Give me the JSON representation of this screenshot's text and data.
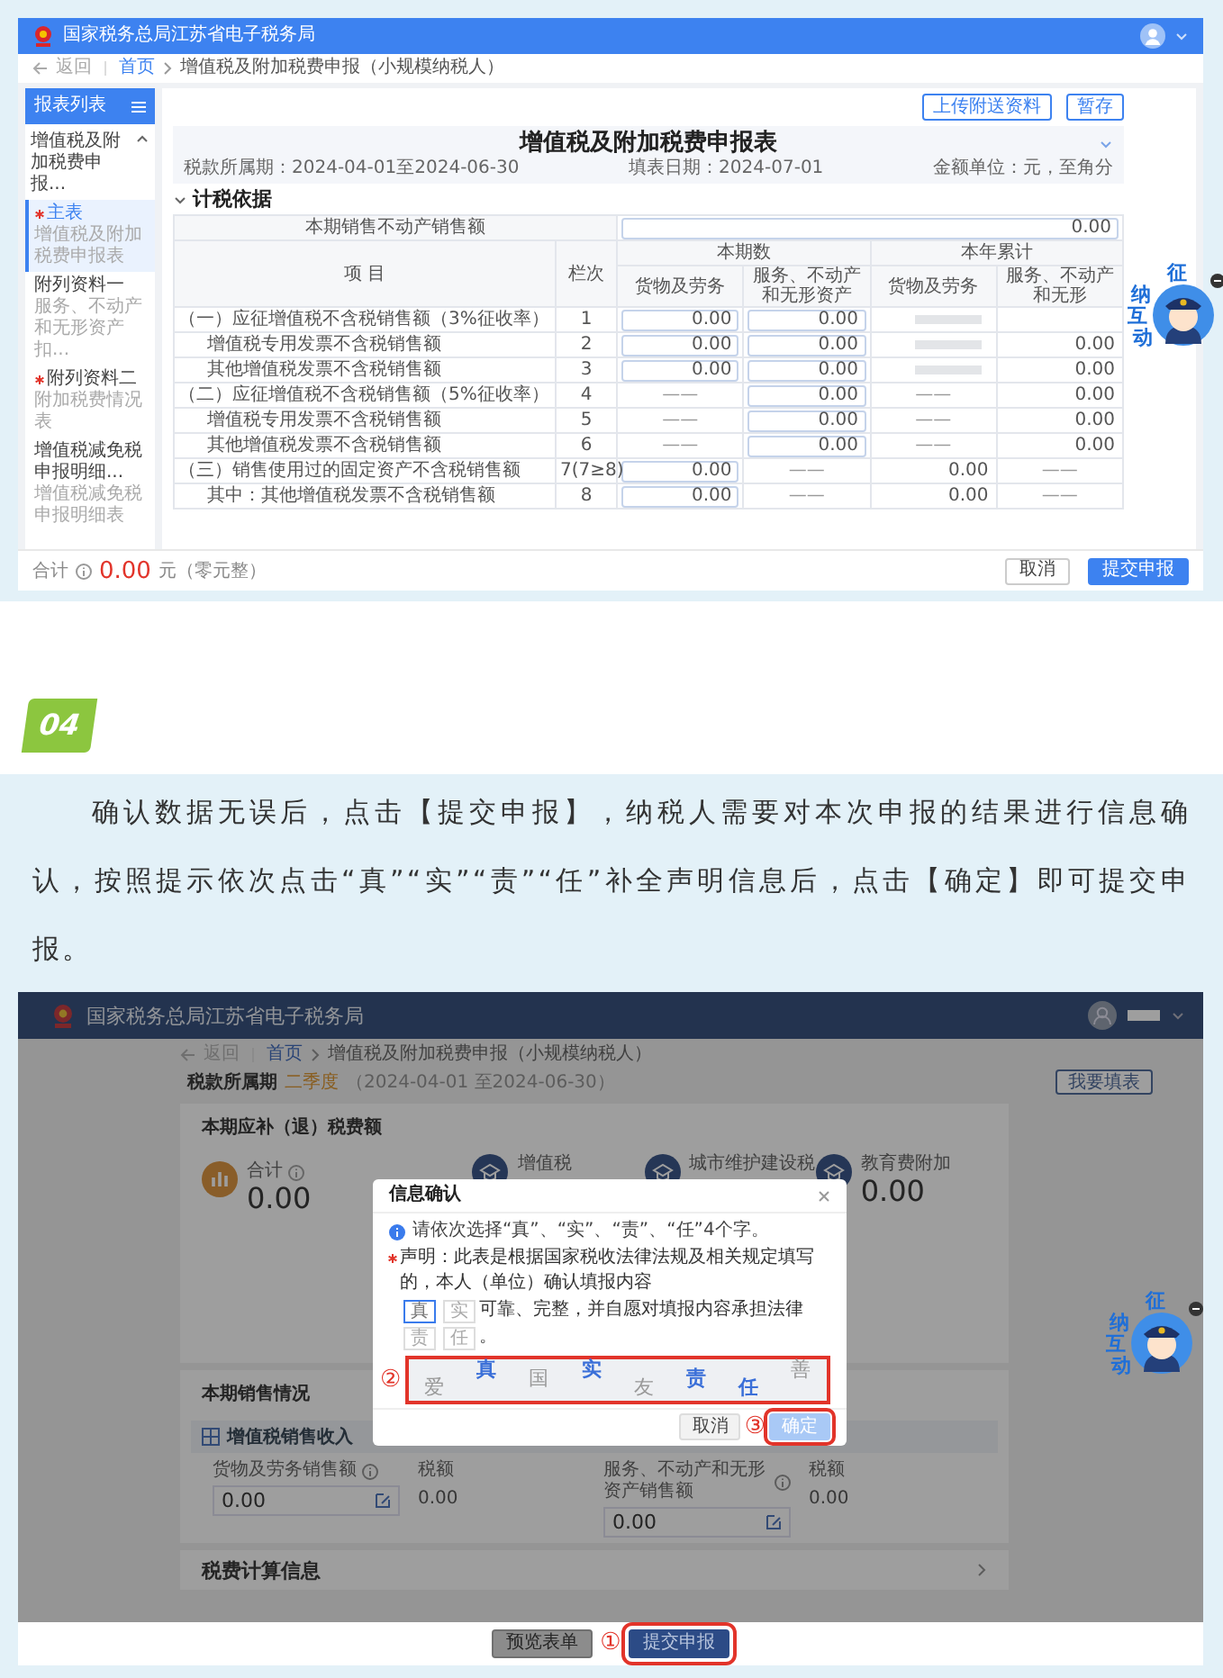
{
  "screenshot_top": {
    "header": {
      "title": "国家税务总局江苏省电子税务局"
    },
    "breadcrumb": {
      "back": "返回",
      "items": [
        "首页",
        "增值税及附加税费申报（小规模纳税人）"
      ]
    },
    "sidebar": {
      "title": "报表列表",
      "group": {
        "label": "增值税及附加税费申报...",
        "expanded": true
      },
      "items": [
        {
          "label": "主表",
          "sublabel": "增值税及附加税费申报表",
          "required": true,
          "selected": true
        },
        {
          "label": "附列资料一",
          "sublabel": "服务、不动产和无形资产扣...",
          "required": false,
          "selected": false
        },
        {
          "label": "附列资料二",
          "sublabel": "附加税费情况表",
          "required": true,
          "selected": false
        },
        {
          "label": "增值税减免税申报明细...",
          "sublabel": "增值税减免税申报明细表",
          "required": false,
          "selected": false
        }
      ]
    },
    "toolbar": [
      "上传附送资料",
      "暂存"
    ],
    "form": {
      "title": "增值税及附加税费申报表",
      "period": "税款所属期：2024-04-01至2024-06-30",
      "fill_date": "填表日期：2024-07-01",
      "unit": "金额单位：元，至角分"
    },
    "section": {
      "title": "计税依据",
      "expanded": true
    },
    "table": {
      "top_row": {
        "label": "本期销售不动产销售额",
        "value": "0.00"
      },
      "column_groups": [
        {
          "label": "本期数"
        },
        {
          "label": "本年累计"
        }
      ],
      "columns": [
        {
          "label": "项 目",
          "grouped": false
        },
        {
          "label": "栏次",
          "grouped": false
        },
        {
          "label": "货物及劳务",
          "grouped": true,
          "group_start": true
        },
        {
          "label": "服务、不动产和无形资产",
          "grouped": true,
          "group_start": false
        },
        {
          "label": "货物及劳务",
          "grouped": true,
          "group_start": true
        },
        {
          "label": "服务、不动产和无形",
          "grouped": true,
          "group_start": false
        }
      ],
      "rows": [
        {
          "cells": [
            {
              "kind": "label",
              "text": "（一）应征增值税不含税销售额（3%征收率）"
            },
            {
              "kind": "line",
              "text": "1"
            },
            {
              "kind": "input",
              "text": "0.00"
            },
            {
              "kind": "input",
              "text": "0.00"
            },
            {
              "kind": "redacted"
            },
            {
              "kind": "empty"
            }
          ],
          "children": [
            {
              "cells": [
                {
                  "kind": "label",
                  "text": "增值税专用发票不含税销售额"
                },
                {
                  "kind": "line",
                  "text": "2"
                },
                {
                  "kind": "input",
                  "text": "0.00"
                },
                {
                  "kind": "input",
                  "text": "0.00"
                },
                {
                  "kind": "redacted"
                },
                {
                  "kind": "value",
                  "text": "0.00"
                }
              ]
            },
            {
              "cells": [
                {
                  "kind": "label",
                  "text": "其他增值税发票不含税销售额"
                },
                {
                  "kind": "line",
                  "text": "3"
                },
                {
                  "kind": "input",
                  "text": "0.00"
                },
                {
                  "kind": "input",
                  "text": "0.00"
                },
                {
                  "kind": "redacted"
                },
                {
                  "kind": "value",
                  "text": "0.00"
                }
              ]
            }
          ]
        },
        {
          "cells": [
            {
              "kind": "label",
              "text": "（二）应征增值税不含税销售额（5%征收率）"
            },
            {
              "kind": "line",
              "text": "4"
            },
            {
              "kind": "dash",
              "text": "——"
            },
            {
              "kind": "input",
              "text": "0.00"
            },
            {
              "kind": "dash",
              "text": "——"
            },
            {
              "kind": "value",
              "text": "0.00"
            }
          ],
          "children": [
            {
              "cells": [
                {
                  "kind": "label",
                  "text": "增值税专用发票不含税销售额"
                },
                {
                  "kind": "line",
                  "text": "5"
                },
                {
                  "kind": "dash",
                  "text": "——"
                },
                {
                  "kind": "input",
                  "text": "0.00"
                },
                {
                  "kind": "dash",
                  "text": "——"
                },
                {
                  "kind": "value",
                  "text": "0.00"
                }
              ]
            },
            {
              "cells": [
                {
                  "kind": "label",
                  "text": "其他增值税发票不含税销售额"
                },
                {
                  "kind": "line",
                  "text": "6"
                },
                {
                  "kind": "dash",
                  "text": "——"
                },
                {
                  "kind": "input",
                  "text": "0.00"
                },
                {
                  "kind": "dash",
                  "text": "——"
                },
                {
                  "kind": "value",
                  "text": "0.00"
                }
              ]
            }
          ]
        },
        {
          "cells": [
            {
              "kind": "label",
              "text": "（三）销售使用过的固定资产不含税销售额"
            },
            {
              "kind": "line",
              "text": "7(7≥8)"
            },
            {
              "kind": "input",
              "text": "0.00"
            },
            {
              "kind": "dash",
              "text": "——"
            },
            {
              "kind": "value",
              "text": "0.00"
            },
            {
              "kind": "dash",
              "text": "——"
            }
          ],
          "children": [
            {
              "cells": [
                {
                  "kind": "label",
                  "text": "其中：其他增值税发票不含税销售额"
                },
                {
                  "kind": "line",
                  "text": "8"
                },
                {
                  "kind": "input",
                  "text": "0.00"
                },
                {
                  "kind": "dash",
                  "text": "——"
                },
                {
                  "kind": "value",
                  "text": "0.00"
                },
                {
                  "kind": "dash",
                  "text": "——"
                }
              ]
            }
          ]
        }
      ]
    },
    "footer": {
      "total_label": "合计",
      "total": "0.00",
      "total_words": "元（零元整）",
      "buttons": [
        {
          "label": "取消",
          "kind": "default"
        },
        {
          "label": "提交申报",
          "kind": "primary"
        }
      ]
    },
    "assistant": {
      "chars": [
        "征",
        "纳",
        "互",
        "动"
      ]
    }
  },
  "step": {
    "number": "04"
  },
  "instruction": "确认数据无误后，点击【提交申报】，纳税人需要对本次申报的结果进行信息确认，按照提示依次点击“真”“实”“责”“任”补全声明信息后，点击【确定】即可提交申报。",
  "screenshot_bottom": {
    "header": {
      "title": "国家税务总局江苏省电子税务局"
    },
    "breadcrumb": {
      "back": "返回",
      "items": [
        "首页",
        "增值税及附加税费申报（小规模纳税人）"
      ]
    },
    "period": {
      "label": "税款所属期",
      "quarter": "二季度",
      "range": "（2024-04-01 至2024-06-30）"
    },
    "fill_button": "我要填表",
    "due": {
      "title": "本期应补（退）税费额",
      "total": {
        "label": "合计",
        "value": "0.00"
      },
      "taxes": [
        {
          "label": "增值税"
        },
        {
          "label": "城市维护建设税"
        },
        {
          "label": "教育费附加",
          "value": "0.00"
        }
      ]
    },
    "sales": {
      "title": "本期销售情况",
      "subtitle": "增值税销售收入",
      "fields": [
        {
          "kind": "input",
          "label": "货物及劳务销售额",
          "value": "0.00"
        },
        {
          "kind": "plain",
          "label": "税额",
          "value": "0.00"
        },
        {
          "kind": "input",
          "label": "服务、不动产和无形资产销售额",
          "value": "0.00"
        },
        {
          "kind": "plain",
          "label": "税额",
          "value": "0.00"
        }
      ]
    },
    "calc_section": "税费计算信息",
    "footer_buttons": [
      {
        "label": "预览表单",
        "kind": "default",
        "highlighted": false
      },
      {
        "label": "提交申报",
        "kind": "primary",
        "highlighted": true,
        "annotation": "①"
      }
    ],
    "dialog": {
      "title": "信息确认",
      "notice": "请依次选择“真”、“实”、“责”、“任”4个字。",
      "required": true,
      "statement": [
        {
          "kind": "text",
          "text": "声明：此表是根据国家税收法律法规及相关规定填写的，本人（单位）确认填报内容"
        },
        {
          "kind": "slot",
          "text": "真",
          "focused": true
        },
        {
          "kind": "slot",
          "text": "实",
          "focused": false
        },
        {
          "kind": "text",
          "text": "可靠、完整，并自愿对填报内容承担法律"
        },
        {
          "kind": "slot",
          "text": "责",
          "focused": false
        },
        {
          "kind": "slot",
          "text": "任",
          "focused": false
        },
        {
          "kind": "text",
          "text": "。"
        }
      ],
      "captcha": {
        "highlighted": true,
        "annotation": "②",
        "chars": [
          {
            "text": "爱",
            "target": false
          },
          {
            "text": "真",
            "target": true
          },
          {
            "text": "国",
            "target": false
          },
          {
            "text": "实",
            "target": true
          },
          {
            "text": "友",
            "target": false
          },
          {
            "text": "责",
            "target": true
          },
          {
            "text": "任",
            "target": true
          },
          {
            "text": "善",
            "target": false
          }
        ]
      },
      "buttons": [
        {
          "label": "取消",
          "kind": "default",
          "highlighted": false
        },
        {
          "label": "确定",
          "kind": "primary",
          "highlighted": true,
          "annotation": "③"
        }
      ]
    },
    "assistant": {
      "chars": [
        "征",
        "纳",
        "互",
        "动"
      ]
    }
  }
}
